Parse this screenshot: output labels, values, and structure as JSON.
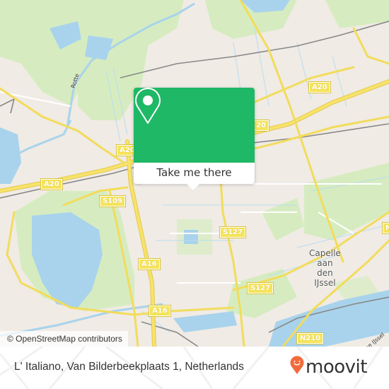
{
  "map": {
    "attribution": "© OpenStreetMap contributors",
    "colors": {
      "land": "#f0ebe5",
      "park": "#d6ecc0",
      "water": "#a9d3ec",
      "motorway": "#f7e36b",
      "rail": "#777777",
      "accent": "#1fb866"
    },
    "road_shields": [
      {
        "label": "A20",
        "id": "a20-west"
      },
      {
        "label": "A20",
        "id": "a20-center"
      },
      {
        "label": "20",
        "id": "a20-popup-right"
      },
      {
        "label": "A20",
        "id": "a20-east"
      },
      {
        "label": "S109",
        "id": "s109"
      },
      {
        "label": "S127",
        "id": "s127-north"
      },
      {
        "label": "S127",
        "id": "s127-south"
      },
      {
        "label": "A16",
        "id": "a16-north"
      },
      {
        "label": "A16",
        "id": "a16-south"
      },
      {
        "label": "N210",
        "id": "n210"
      },
      {
        "label": "N",
        "id": "n-east"
      }
    ],
    "place_labels": [
      {
        "label": "Capelle\naan\nden\nIJssel",
        "id": "capelle"
      }
    ],
    "water_labels": [
      {
        "label": "Rotte",
        "id": "rotte"
      },
      {
        "label": "se IJssel",
        "id": "hollandse-ijssel"
      }
    ]
  },
  "popup": {
    "icon": "map-pin-icon",
    "button_label": "Take me there"
  },
  "footer": {
    "address": "L' Italiano, Van Bilderbeekplaats 1, Netherlands",
    "brand": "moovit",
    "brand_icon": "moovit-smiley-pin-icon",
    "brand_color": "#f26a3c"
  }
}
